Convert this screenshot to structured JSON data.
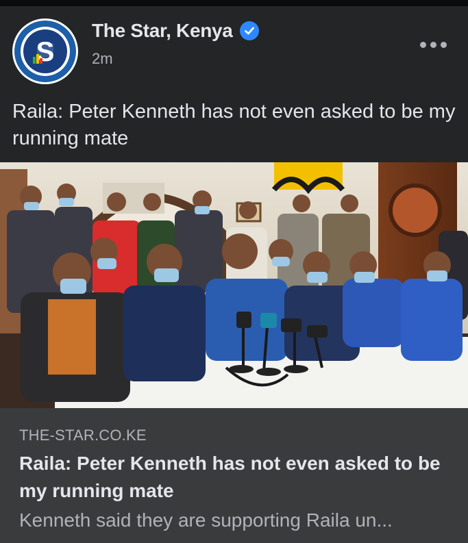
{
  "post": {
    "page_name": "The Star, Kenya",
    "verified": true,
    "timestamp": "2m",
    "caption": "Raila: Peter Kenneth has not even asked to be my running mate",
    "avatar_letter": "S",
    "more_icon": "more-horizontal-icon"
  },
  "link_preview": {
    "domain": "THE-STAR.CO.KE",
    "headline": "Raila: Peter Kenneth has not even asked to be my running mate",
    "snippet": "Kenneth said they are supporting Raila un..."
  },
  "colors": {
    "background": "#242526",
    "link_box": "#3a3b3c",
    "primary_text": "#e4e6eb",
    "secondary_text": "#b0b3b8",
    "verified_blue": "#2d88ff",
    "brand_blue": "#1d5fa8"
  }
}
